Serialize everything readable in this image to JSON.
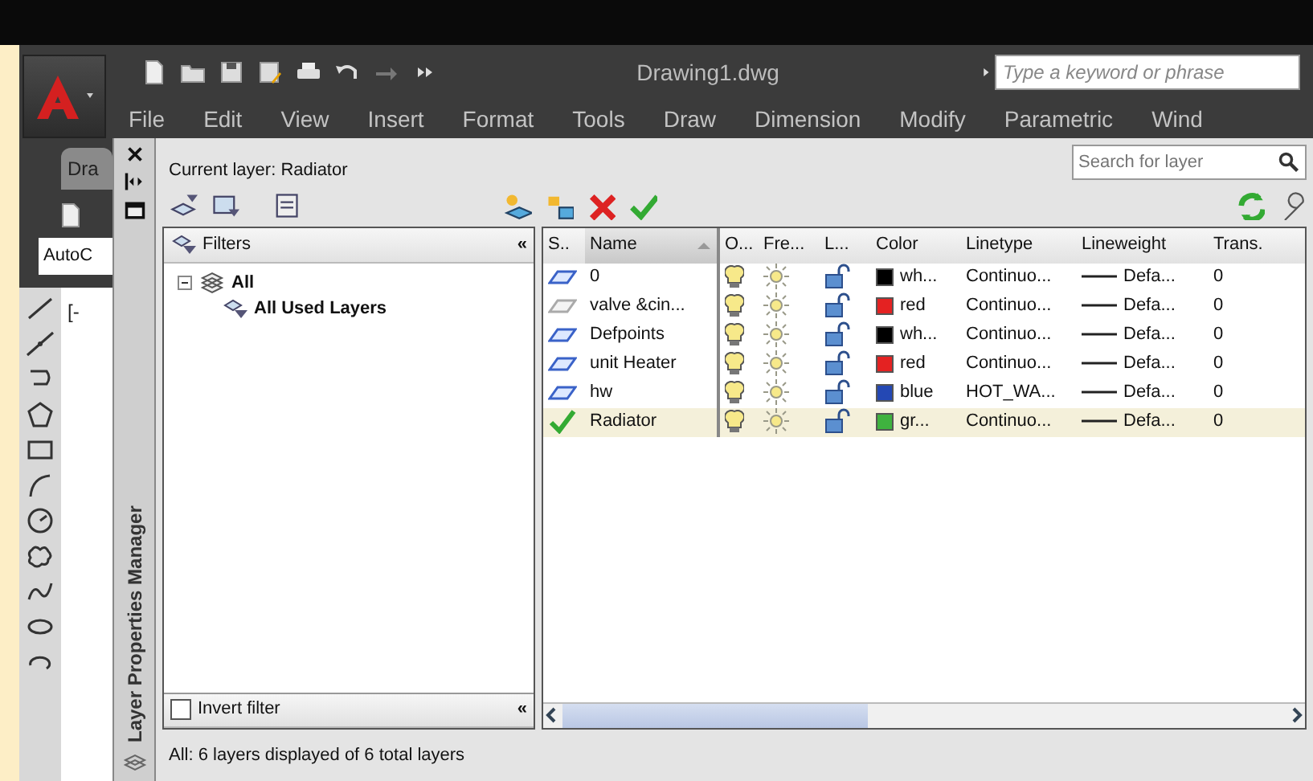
{
  "app": {
    "title": "Drawing1.dwg",
    "search": {
      "placeholder": "Type a keyword or phrase"
    },
    "menu": [
      "File",
      "Edit",
      "View",
      "Insert",
      "Format",
      "Tools",
      "Draw",
      "Dimension",
      "Modify",
      "Parametric",
      "Wind"
    ],
    "doc_tab": "Dra",
    "workspace_combo": "AutoC",
    "viewport_label": "[-"
  },
  "palette": {
    "title": "Layer Properties Manager",
    "current_layer": "Current layer: Radiator",
    "search": {
      "placeholder": "Search for layer"
    },
    "filters": {
      "header": "Filters",
      "collapse": "«",
      "tree": [
        {
          "label": "All",
          "expanded": true,
          "children": [
            {
              "label": "All Used Layers"
            }
          ]
        }
      ],
      "invert_filter": {
        "label": "Invert filter",
        "checked": false
      },
      "collapse_bottom": "«"
    },
    "layers": {
      "columns": [
        {
          "label": "S..",
          "sorted": false
        },
        {
          "label": "Name",
          "sorted": true
        },
        {
          "label": "O...",
          "sorted": false
        },
        {
          "label": "Fre...",
          "sorted": false
        },
        {
          "label": "L...",
          "sorted": false
        },
        {
          "label": "Color",
          "sorted": false
        },
        {
          "label": "Linetype",
          "sorted": false
        },
        {
          "label": "Lineweight",
          "sorted": false
        },
        {
          "label": "Trans.",
          "sorted": false
        }
      ],
      "rows": [
        {
          "kind": "used",
          "name": "0",
          "on": true,
          "frozen": false,
          "locked": false,
          "color": "#000000",
          "color_name": "wh...",
          "linetype": "Continuo...",
          "lineweight": "Defa...",
          "transparency": "0",
          "selected": false
        },
        {
          "kind": "unused",
          "name": "valve &cin...",
          "on": true,
          "frozen": false,
          "locked": false,
          "color": "#e42222",
          "color_name": "red",
          "linetype": "Continuo...",
          "lineweight": "Defa...",
          "transparency": "0",
          "selected": false
        },
        {
          "kind": "used",
          "name": "Defpoints",
          "on": true,
          "frozen": false,
          "locked": false,
          "color": "#000000",
          "color_name": "wh...",
          "linetype": "Continuo...",
          "lineweight": "Defa...",
          "transparency": "0",
          "selected": false
        },
        {
          "kind": "used",
          "name": "unit Heater",
          "on": true,
          "frozen": false,
          "locked": false,
          "color": "#e42222",
          "color_name": "red",
          "linetype": "Continuo...",
          "lineweight": "Defa...",
          "transparency": "0",
          "selected": false
        },
        {
          "kind": "used",
          "name": "hw",
          "on": true,
          "frozen": false,
          "locked": false,
          "color": "#2448b4",
          "color_name": "blue",
          "linetype": "HOT_WA...",
          "lineweight": "Defa...",
          "transparency": "0",
          "selected": false
        },
        {
          "kind": "current",
          "name": "Radiator",
          "on": true,
          "frozen": false,
          "locked": false,
          "color": "#3fb23f",
          "color_name": "gr...",
          "linetype": "Continuo...",
          "lineweight": "Defa...",
          "transparency": "0",
          "selected": true
        }
      ]
    },
    "status": "All: 6 layers displayed of 6 total layers"
  }
}
